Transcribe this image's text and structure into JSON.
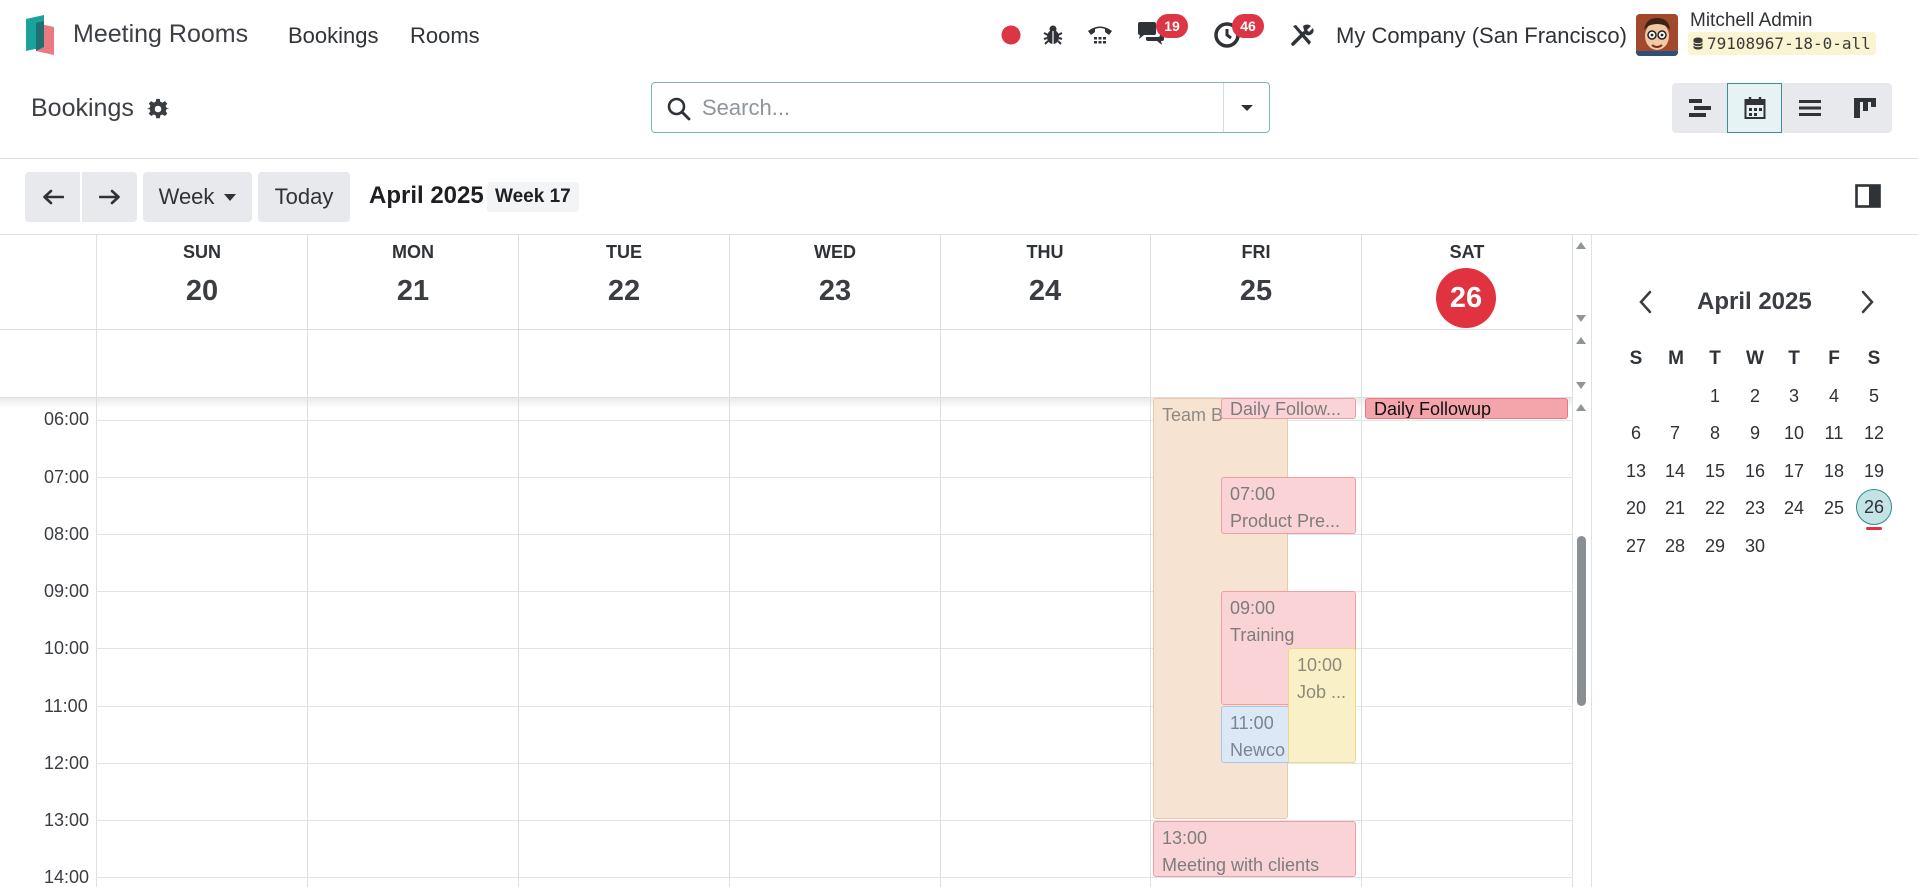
{
  "navbar": {
    "app_name": "Meeting Rooms",
    "menus": [
      "Bookings",
      "Rooms"
    ],
    "chat_count": "19",
    "activity_count": "46",
    "company": "My Company (San Francisco)",
    "user_name": "Mitchell Admin",
    "db_name": "79108967-18-0-all"
  },
  "control_panel": {
    "breadcrumb": "Bookings",
    "search_placeholder": "Search...",
    "views": [
      "Gantt",
      "Calendar",
      "List",
      "Kanban"
    ],
    "active_view": "Calendar"
  },
  "toolbar": {
    "week_label": "Week",
    "today_label": "Today",
    "range_title": "April 2025",
    "week_tag": "Week 17"
  },
  "calendar": {
    "days": [
      {
        "name": "SUN",
        "num": "20"
      },
      {
        "name": "MON",
        "num": "21"
      },
      {
        "name": "TUE",
        "num": "22"
      },
      {
        "name": "WED",
        "num": "23"
      },
      {
        "name": "THU",
        "num": "24"
      },
      {
        "name": "FRI",
        "num": "25"
      },
      {
        "name": "SAT",
        "num": "26"
      }
    ],
    "today_num": "26",
    "hours": [
      "06:00",
      "07:00",
      "08:00",
      "09:00",
      "10:00",
      "11:00",
      "12:00",
      "13:00",
      "14:00"
    ],
    "events": [
      {
        "title": "Team B",
        "time": ""
      },
      {
        "title": "Daily Follow...",
        "time": ""
      },
      {
        "title": "Daily Followup",
        "time": ""
      },
      {
        "title": "Product Pre...",
        "time": "07:00"
      },
      {
        "title": "Training",
        "time": "09:00"
      },
      {
        "title": "Job ...",
        "time": "10:00"
      },
      {
        "title": "Newco",
        "time": "11:00"
      },
      {
        "title": "Meeting with clients",
        "time": "13:00"
      }
    ]
  },
  "mini_calendar": {
    "title": "April 2025",
    "dow": [
      "S",
      "M",
      "T",
      "W",
      "T",
      "F",
      "S"
    ],
    "weeks": [
      [
        "",
        "",
        "1",
        "2",
        "3",
        "4",
        "5"
      ],
      [
        "6",
        "7",
        "8",
        "9",
        "10",
        "11",
        "12"
      ],
      [
        "13",
        "14",
        "15",
        "16",
        "17",
        "18",
        "19"
      ],
      [
        "20",
        "21",
        "22",
        "23",
        "24",
        "25",
        "26"
      ],
      [
        "27",
        "28",
        "29",
        "30",
        "",
        "",
        ""
      ]
    ],
    "today": "26"
  },
  "colors": {
    "accent": "#017e84",
    "today_red": "#e0323f",
    "badge_red": "#dc3545"
  }
}
